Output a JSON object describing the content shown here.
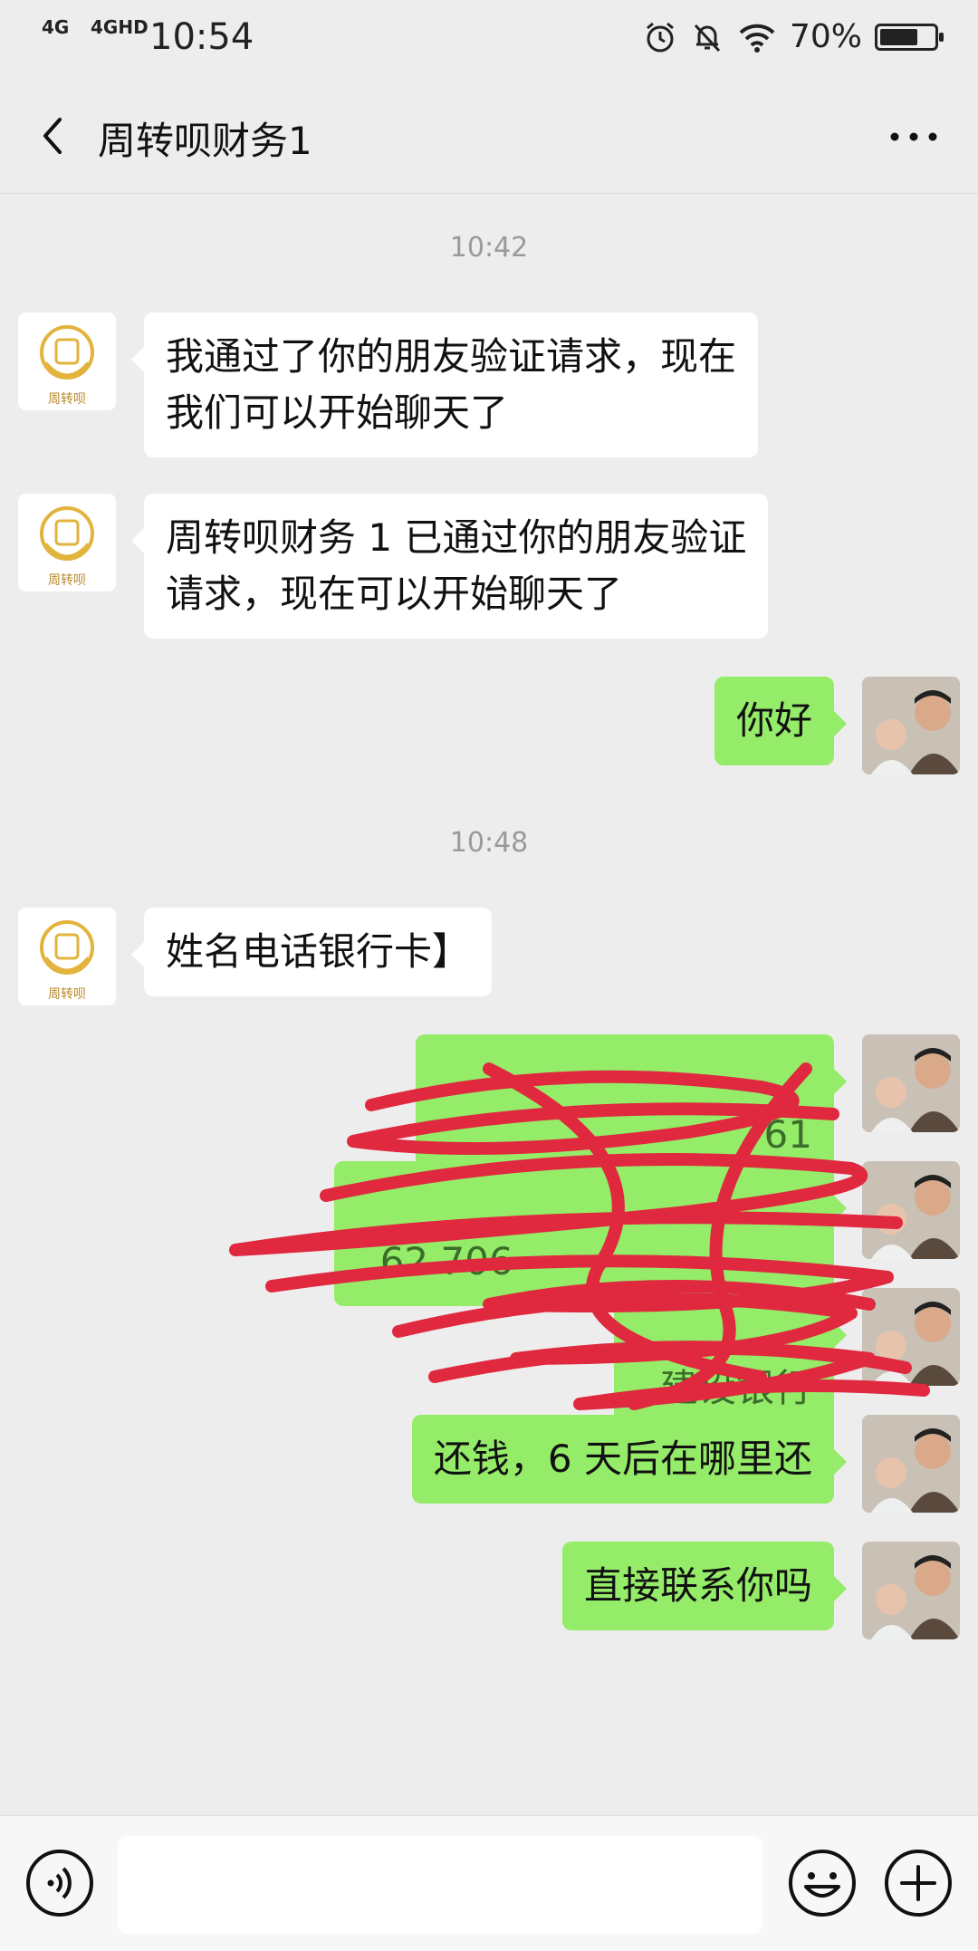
{
  "status_bar": {
    "network1": "4G",
    "network2": "4GHD",
    "time": "10:54",
    "battery_pct": "70%",
    "battery_level": 0.7
  },
  "header": {
    "title": "周转呗财务1"
  },
  "messages": [
    {
      "type": "timestamp",
      "text": "10:42"
    },
    {
      "type": "in",
      "text": "我通过了你的朋友验证请求，现在\n我们可以开始聊天了"
    },
    {
      "type": "in",
      "text": "周转呗财务 1 已通过你的朋友验证\n请求，现在可以开始聊天了"
    },
    {
      "type": "out",
      "text": "你好"
    },
    {
      "type": "timestamp",
      "text": "10:48"
    },
    {
      "type": "in",
      "text": "姓名电话银行卡】"
    },
    {
      "type": "out_redacted",
      "text": "61"
    },
    {
      "type": "out_redacted",
      "text": "62 706"
    },
    {
      "type": "out_redacted",
      "text": "建设银行"
    },
    {
      "type": "out",
      "text": "还钱，6 天后在哪里还"
    },
    {
      "type": "out",
      "text": "直接联系你吗"
    }
  ],
  "contact_avatar_text": "周转呗",
  "colors": {
    "background": "#ededed",
    "bubble_out": "#95ec69",
    "bubble_in": "#ffffff",
    "scribble": "#e0283e"
  }
}
